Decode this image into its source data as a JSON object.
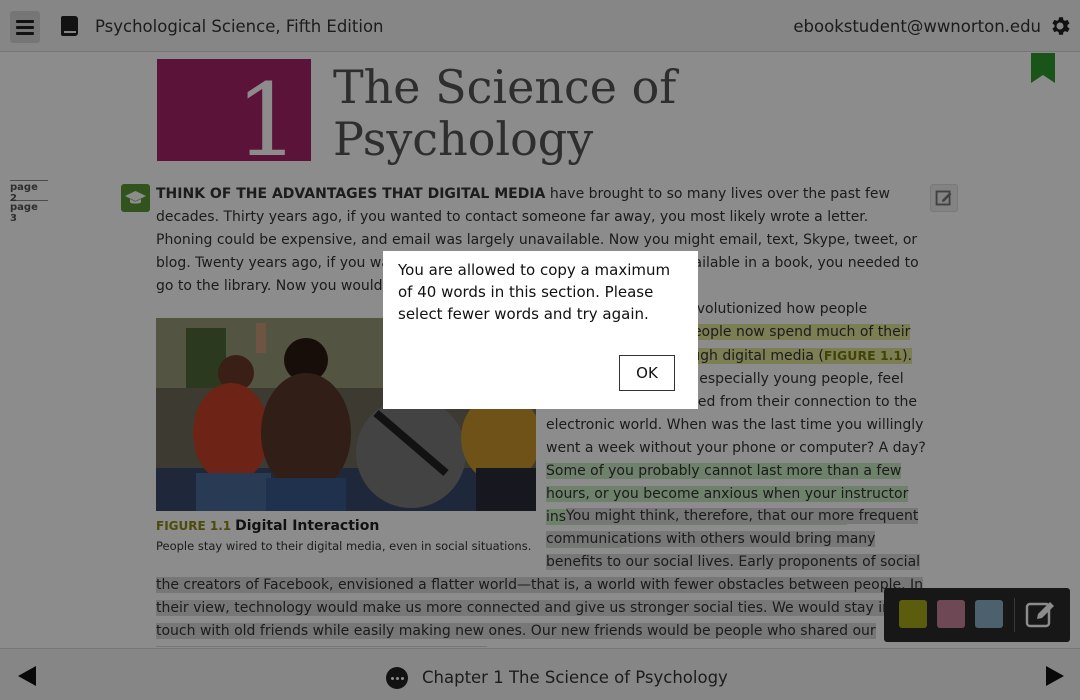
{
  "header": {
    "book_title": "Psychological Science, Fifth Edition",
    "user_email": "ebookstudent@wwnorton.edu"
  },
  "chapter": {
    "number": "1",
    "title_line1": "The Science of",
    "title_line2": "Psychology",
    "color": "#a8246a"
  },
  "page_markers": [
    "page 2",
    "page 3"
  ],
  "paragraph1": {
    "lead": "THINK OF THE ADVANTAGES THAT DIGITAL MEDIA",
    "text": " have brought to so many lives over the past few decades. Thirty years ago, if you wanted to contact someone far away, you most likely wrote a letter. Phoning could be expensive, and email was largely unavailable. Now you might email, text, Skype, tweet, or blog. Twenty years ago, if you wanted a piece of information that was not available in a book, you needed to go to the library. Now you would probably go straight to the Internet."
  },
  "paragraph2": {
    "part1": "Digital media have revolutionized how people interact. ",
    "highlight_yellow": "Millions of people now spend much of their lives interacting through digital media (",
    "figure_ref": "FIGURE 1.1",
    "highlight_yellow_end": ").",
    "part2": " In fact, many people, especially young people, feel panicky to be separated from their connection to the electronic world. When was the last time you willingly went a week without your phone or computer? A day? ",
    "highlight_green": "Some of you probably cannot last more than a few hours, or you become anxious when your instructor insists that cell phones be turned off in the classroom."
  },
  "paragraph3": {
    "text": "You might think, therefore, that our more frequent communications with others would bring many benefits to our social lives. Early proponents of social media, such as"
  },
  "paragraph4": {
    "text": "the creators of Facebook, envisioned a flatter world—that is, a world with fewer obstacles between people. In their view, technology would make us more connected and give us stronger social ties. We would stay in touch with old friends while easily making new ones. Our new friends would be people who shared our interests, whether they lived on the next street"
  },
  "figure": {
    "number": "FIGURE 1.1",
    "title": "Digital Interaction",
    "caption": "People stay wired to their digital media, even in social situations."
  },
  "highlight_colors": {
    "yellow": "#a8a81c",
    "pink": "#c9839b",
    "blue": "#8ab0c8"
  },
  "footer": {
    "chapter_label": "Chapter 1 The Science of Psychology"
  },
  "dialog": {
    "message": "You are allowed to copy a maximum of 40 words in this section. Please select fewer words and try again.",
    "ok_label": "OK"
  }
}
